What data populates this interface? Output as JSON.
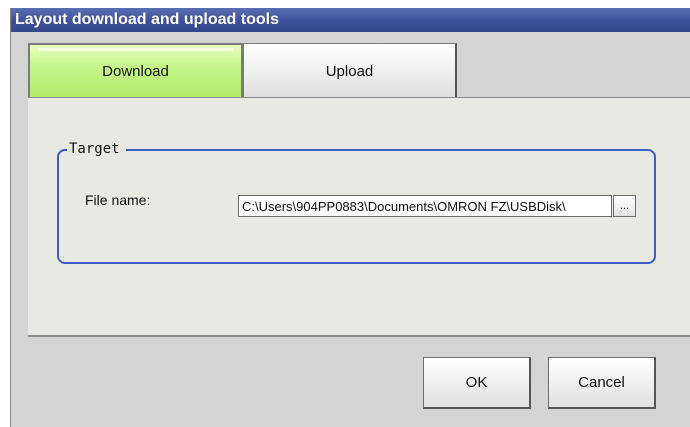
{
  "window": {
    "title": "Layout download and upload tools"
  },
  "tabs": [
    {
      "label": "Download",
      "active": true
    },
    {
      "label": "Upload",
      "active": false
    }
  ],
  "target": {
    "group_title": "Target",
    "file_name_label": "File name:",
    "file_name_value": "C:\\Users\\904PP0883\\Documents\\OMRON FZ\\USBDisk\\",
    "browse_label": "..."
  },
  "buttons": {
    "ok": "OK",
    "cancel": "Cancel"
  },
  "colors": {
    "titlebar": "#3c4f98",
    "active_tab": "#c6f58a",
    "group_border": "#3b5ec4"
  }
}
